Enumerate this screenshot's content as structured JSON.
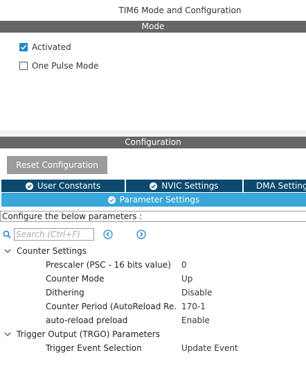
{
  "window": {
    "title": "TIM6 Mode and Configuration"
  },
  "mode_section": {
    "header": "Mode",
    "options": [
      {
        "label": "Activated",
        "checked": true
      },
      {
        "label": "One Pulse Mode",
        "checked": false
      }
    ]
  },
  "config_section": {
    "header": "Configuration",
    "reset_button": "Reset Configuration",
    "tabs": [
      {
        "label": "User Constants",
        "icon": "check-circle-icon"
      },
      {
        "label": "NVIC Settings",
        "icon": "check-circle-icon"
      },
      {
        "label": "DMA Settings",
        "icon": "check-circle-icon"
      }
    ],
    "active_tab": {
      "label": "Parameter Settings",
      "icon": "check-circle-icon"
    },
    "hint": "Configure the below parameters :",
    "search": {
      "placeholder": "Search (Ctrl+F)"
    }
  },
  "parameters": {
    "groups": [
      {
        "label": "Counter Settings",
        "expanded": true,
        "items": [
          {
            "name": "Prescaler (PSC - 16 bits value)",
            "value": "0"
          },
          {
            "name": "Counter Mode",
            "value": "Up"
          },
          {
            "name": "Dithering",
            "value": "Disable"
          },
          {
            "name": "Counter Period (AutoReload Re...",
            "value": "170-1"
          },
          {
            "name": "auto-reload preload",
            "value": "Enable"
          }
        ]
      },
      {
        "label": "Trigger Output (TRGO) Parameters",
        "expanded": true,
        "items": [
          {
            "name": "Trigger Event Selection",
            "value": "Update Event"
          }
        ]
      }
    ]
  },
  "colors": {
    "section_bar": "#666666",
    "tab_dark": "#0b4a6e",
    "tab_active": "#3aa6d9",
    "checkbox_accent": "#1e88c7",
    "button_gray": "#9b9b9b"
  }
}
